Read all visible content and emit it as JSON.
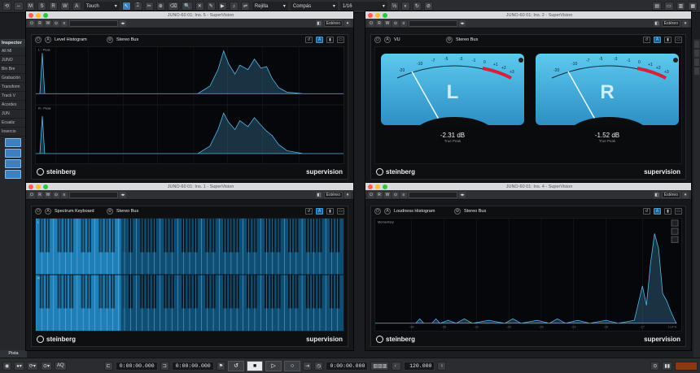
{
  "toolbar": {
    "mode_buttons": [
      "M",
      "S",
      "R",
      "W",
      "A"
    ],
    "automation_mode": "Touch",
    "grid_label": "Rejilla",
    "grid_type": "Compás",
    "quantize": "1/16",
    "window_title_snippet": "selecc"
  },
  "inspector": {
    "title": "Inspector",
    "rows": [
      "All MI",
      "JUNO",
      "Bin Bre",
      "Grabación",
      "Transform",
      "Track V",
      "Acordes",
      "JUN",
      "Ecualiz",
      "Insercio"
    ],
    "tab_label": "Pista",
    "edit_tab": "Editar"
  },
  "windows": [
    {
      "title": "JUNO-60 01: Ins. 5 - SuperVision",
      "plugin_name": "Level Histogram",
      "bus": "Stereo Bus",
      "channels": [
        "L - Peak",
        "R - Peak"
      ],
      "x_ticks": [
        "-60",
        "-50",
        "-40",
        "-30",
        "-20",
        "-15",
        "-10",
        "-5",
        "+5"
      ],
      "x_ticks_r": [
        "-60",
        "-50",
        "-40",
        "-30",
        "-20",
        "-15",
        "-10",
        "-5",
        "+0"
      ],
      "mode": "Estéreo"
    },
    {
      "title": "JUNO-60 01: Ins. 2 - SuperVision",
      "plugin_name": "VU",
      "bus": "Stereo Bus",
      "meters": [
        {
          "label": "L",
          "value_text": "-2.31 dB",
          "sub": "True Peak",
          "value": -2.31
        },
        {
          "label": "R",
          "value_text": "-1.52 dB",
          "sub": "True Peak",
          "value": -1.52
        }
      ],
      "scale": [
        "-20",
        "-10",
        "-7",
        "-5",
        "-3",
        "-1",
        "0",
        "+1",
        "+2",
        "+3"
      ],
      "mode": "Estéreo"
    },
    {
      "title": "JUNO-60 01: Ins. 1 - SuperVision",
      "plugin_name": "Spectrum Keyboard",
      "bus": "Stereo Bus",
      "channels": [
        "L",
        "R"
      ],
      "mode": "Estéreo"
    },
    {
      "title": "JUNO-60 01: Ins. 4 - SuperVision",
      "plugin_name": "Loudness Histogram",
      "bus": "Stereo Bus",
      "channel": "Momentary",
      "x_ticks": [
        "-38",
        "-35",
        "-32",
        "-29",
        "-26",
        "-23",
        "-20",
        "-17",
        "LUFS"
      ],
      "mode": "Estéreo"
    }
  ],
  "footer": {
    "brand": "steinberg",
    "product": "supervision"
  },
  "transport": {
    "left_time": "0:00:00.000",
    "right_time": "0:00:00.000",
    "position": "0:00:00.000",
    "tempo": "120.000",
    "aq_label": "AQ"
  },
  "colors": {
    "accent": "#3d9ad6",
    "meter_face": "#5cc9ef",
    "histogram": "#55b8ea"
  }
}
